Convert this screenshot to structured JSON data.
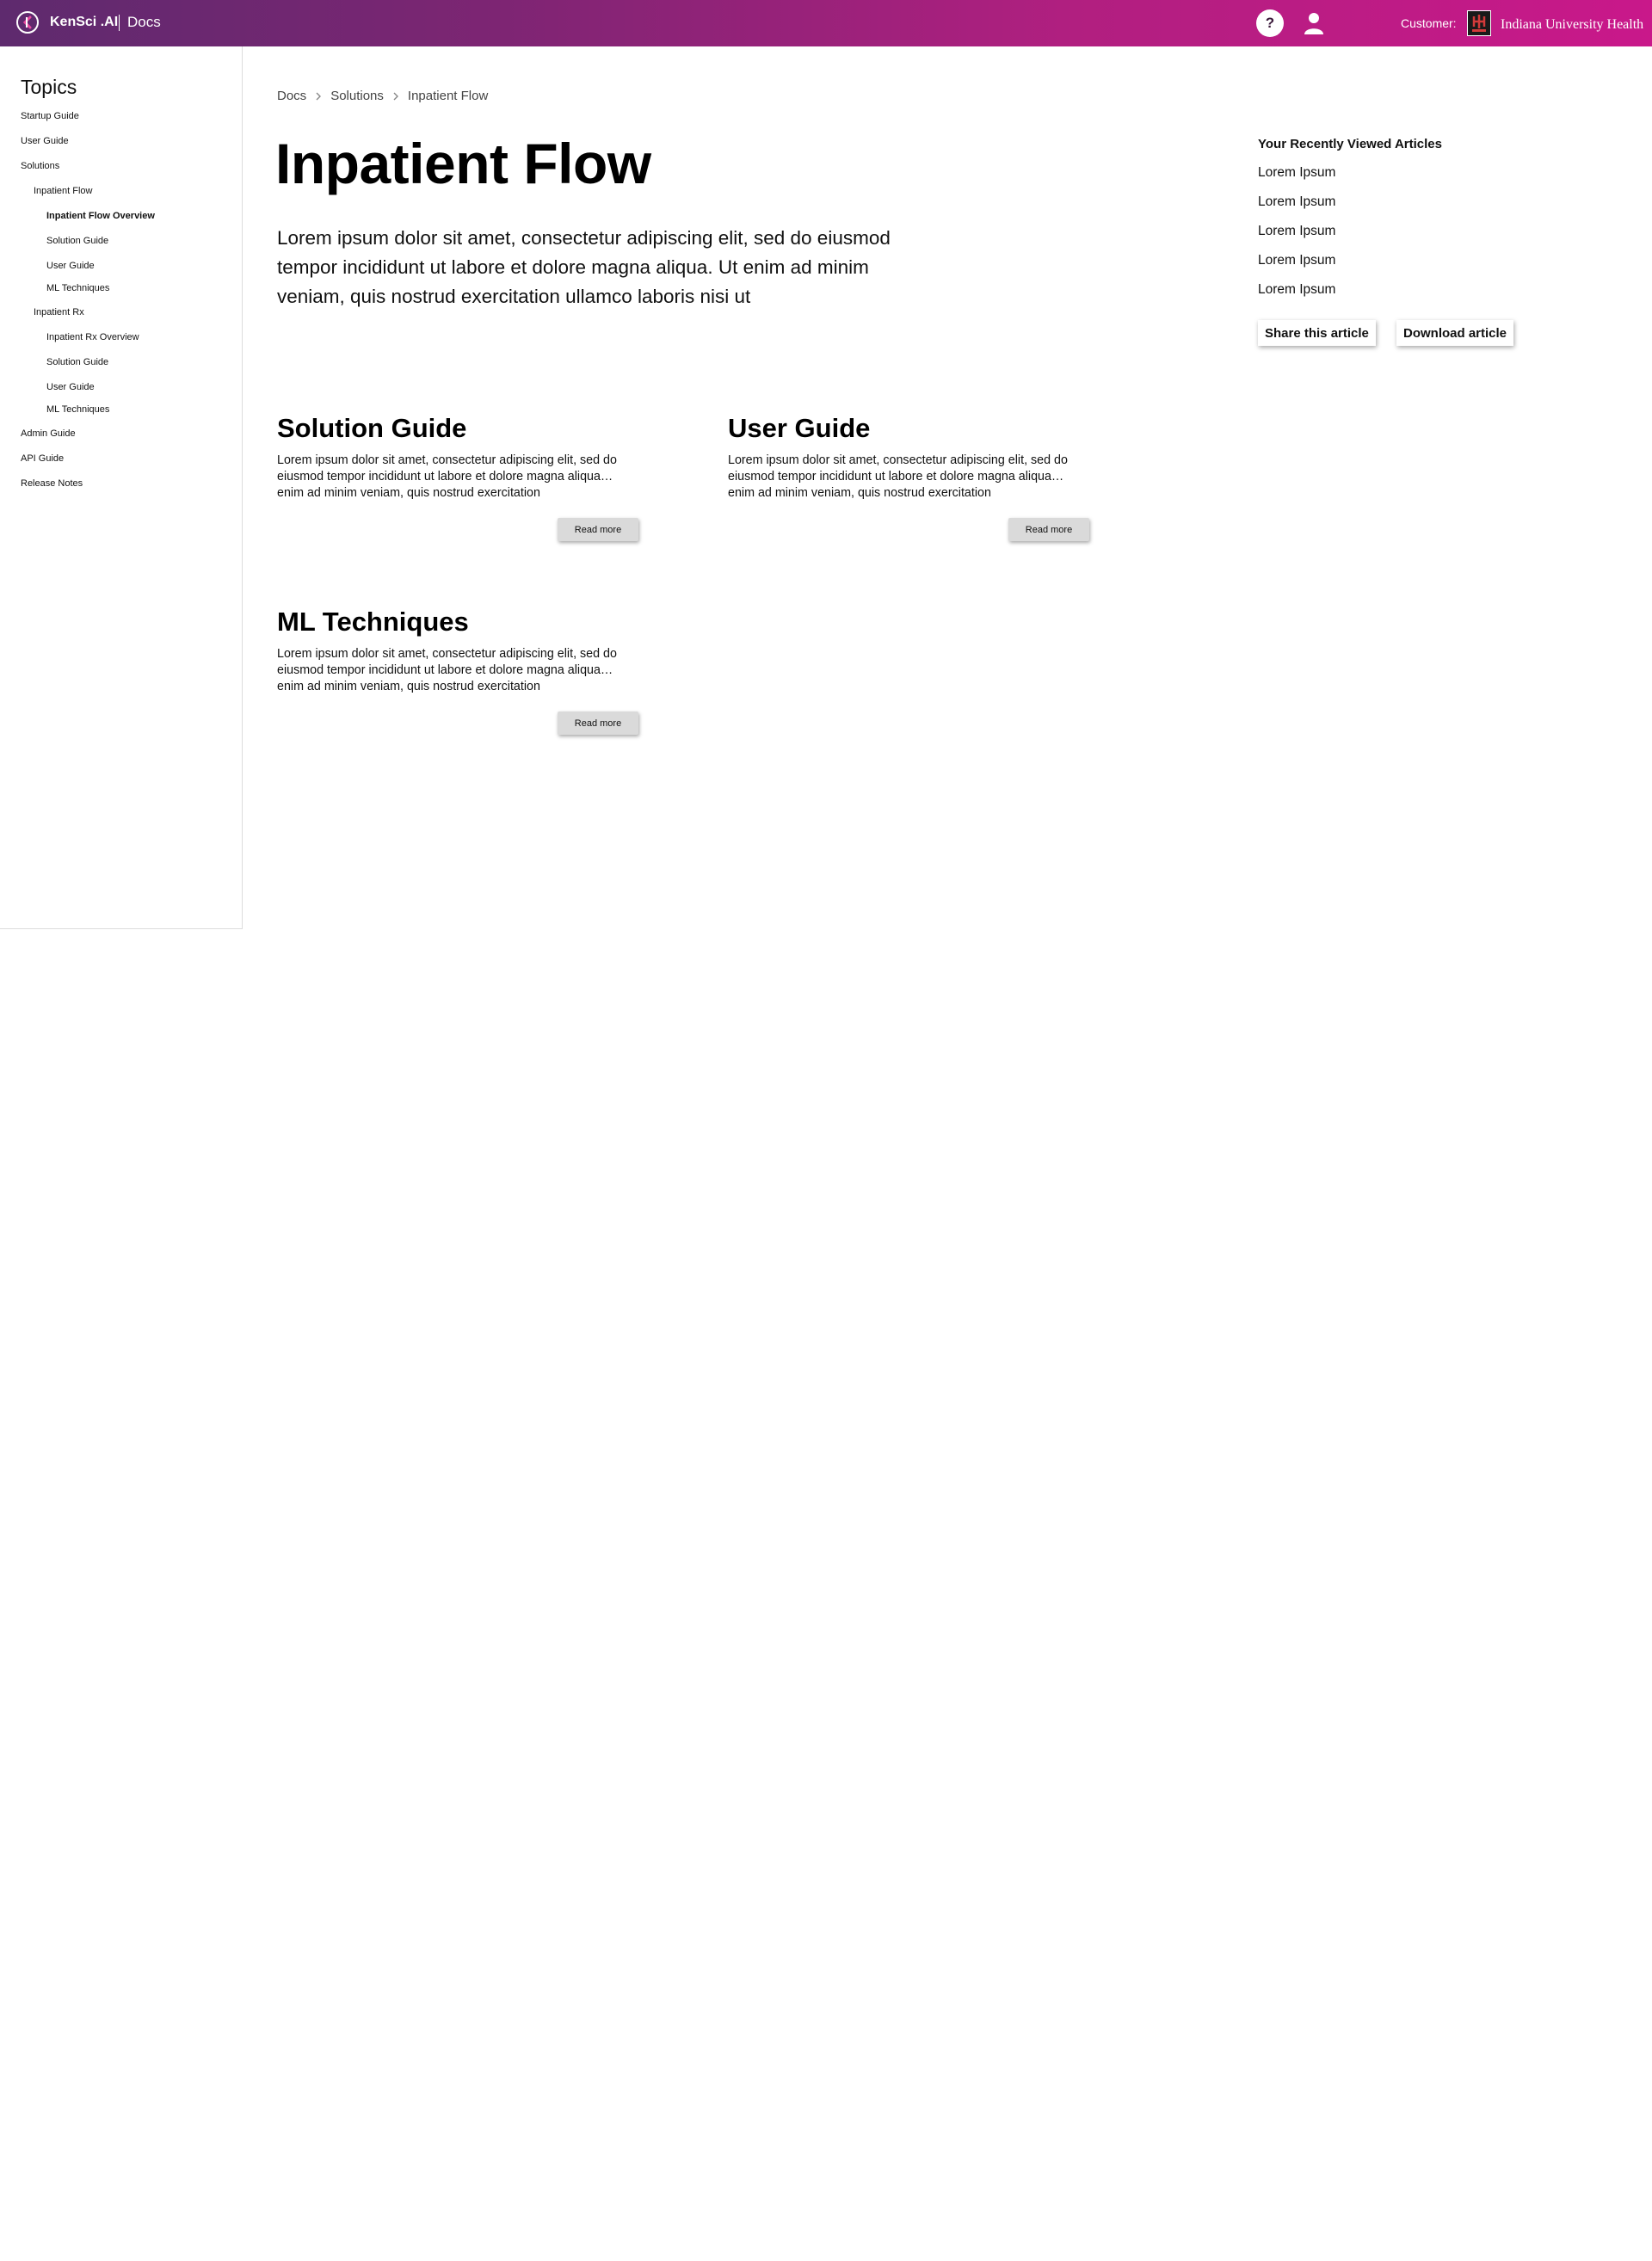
{
  "header": {
    "brand_name": "KenSci .AI",
    "section": "Docs",
    "help_icon_glyph": "?",
    "customer_label": "Customer:",
    "customer_name": "Indiana University Health",
    "gradient_start": "#5e2a6e",
    "gradient_end": "#c9188a"
  },
  "sidebar": {
    "title": "Topics",
    "items": [
      {
        "label": "Startup Guide"
      },
      {
        "label": "User Guide"
      },
      {
        "label": "Solutions"
      },
      {
        "label": "Inpatient Flow"
      },
      {
        "label": "Inpatient Flow Overview",
        "active": true
      },
      {
        "label": "Solution Guide"
      },
      {
        "label": "User Guide"
      },
      {
        "label": "ML Techniques"
      },
      {
        "label": "Inpatient Rx"
      },
      {
        "label": "Inpatient Rx Overview"
      },
      {
        "label": "Solution Guide"
      },
      {
        "label": "User Guide"
      },
      {
        "label": "ML Techniques"
      },
      {
        "label": "Admin Guide"
      },
      {
        "label": "API Guide"
      },
      {
        "label": "Release Notes"
      }
    ]
  },
  "breadcrumb": [
    "Docs",
    "Solutions",
    "Inpatient Flow"
  ],
  "main": {
    "title": "Inpatient Flow",
    "intro": "Lorem ipsum dolor sit amet, consectetur adipiscing elit, sed do eiusmod tempor incididunt ut labore et dolore magna aliqua. Ut enim ad minim veniam, quis nostrud exercitation ullamco laboris nisi ut",
    "cards": [
      {
        "title": "Solution Guide",
        "text": "Lorem ipsum dolor sit amet, consectetur adipiscing elit, sed do eiusmod tempor incididunt ut labore et dolore magna aliqua… enim ad minim veniam, quis nostrud exercitation",
        "button": "Read more"
      },
      {
        "title": "User Guide",
        "text": "Lorem ipsum dolor sit amet, consectetur adipiscing elit, sed do eiusmod tempor incididunt ut labore et dolore magna aliqua… enim ad minim veniam, quis nostrud exercitation",
        "button": "Read more"
      },
      {
        "title": "ML Techniques",
        "text": "Lorem ipsum dolor sit amet, consectetur adipiscing elit, sed do eiusmod tempor incididunt ut labore et dolore magna aliqua… enim ad minim veniam, quis nostrud exercitation",
        "button": "Read more"
      }
    ]
  },
  "recent": {
    "title": "Your Recently Viewed Articles",
    "items": [
      "Lorem Ipsum",
      "Lorem Ipsum",
      "Lorem Ipsum",
      "Lorem Ipsum",
      "Lorem Ipsum"
    ],
    "share_label": "Share this article",
    "download_label": "Download article"
  }
}
